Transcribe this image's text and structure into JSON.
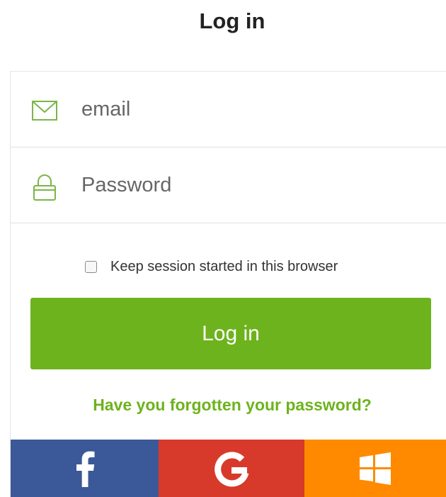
{
  "header": {
    "title": "Log in"
  },
  "form": {
    "email": {
      "placeholder": "email",
      "value": "",
      "icon": "envelope-icon"
    },
    "password": {
      "placeholder": "Password",
      "value": "",
      "icon": "lock-icon"
    },
    "keep_session": {
      "label": "Keep session started in this browser",
      "checked": false
    },
    "submit_label": "Log in",
    "forgot_link": "Have you forgotten your password?"
  },
  "social_login": [
    {
      "provider": "facebook",
      "icon": "facebook-icon",
      "color": "#3b5998"
    },
    {
      "provider": "google",
      "icon": "google-icon",
      "color": "#d73a2a"
    },
    {
      "provider": "windows",
      "icon": "windows-icon",
      "color": "#ff8a00"
    }
  ],
  "colors": {
    "accent": "#6db31d",
    "icon_green": "#7ab648",
    "border": "#e1e1e1"
  }
}
